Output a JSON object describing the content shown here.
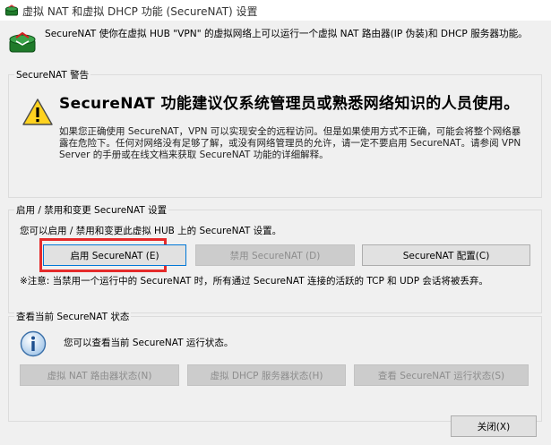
{
  "window": {
    "title": "虚拟 NAT 和虚拟 DHCP 功能 (SecureNAT) 设置"
  },
  "header": {
    "description": "SecureNAT 使你在虚拟 HUB \"VPN\" 的虚拟网络上可以运行一个虚拟 NAT 路由器(IP 伪装)和 DHCP 服务器功能。"
  },
  "warning_group": {
    "title": "SecureNAT 警告",
    "heading": "SecureNAT 功能建议仅系统管理员或熟悉网络知识的人员使用。",
    "body": "如果您正确使用 SecureNAT，VPN 可以实现安全的远程访问。但是如果使用方式不正确，可能会将整个网络暴露在危险下。任何对网络没有足够了解，或没有网络管理员的允许，请一定不要启用 SecureNAT。请参阅 VPN Server 的手册或在线文档来获取 SecureNAT 功能的详细解释。"
  },
  "enable_group": {
    "title": "启用 / 禁用和变更 SecureNAT 设置",
    "description": "您可以启用 / 禁用和变更此虚拟 HUB 上的 SecureNAT 设置。",
    "enable_label": "启用 SecureNAT (E)",
    "disable_label": "禁用 SecureNAT (D)",
    "config_label": "SecureNAT 配置(C)",
    "note": "※注意: 当禁用一个运行中的 SecureNAT 时，所有通过 SecureNAT 连接的活跃的 TCP 和 UDP 会话将被丢弃。"
  },
  "status_group": {
    "title": "查看当前 SecureNAT 状态",
    "description": "您可以查看当前 SecureNAT 运行状态。",
    "nat_status_label": "虚拟 NAT 路由器状态(N)",
    "dhcp_status_label": "虚拟 DHCP 服务器状态(H)",
    "securenat_status_label": "查看 SecureNAT 运行状态(S)"
  },
  "footer": {
    "close_label": "关闭(X)"
  }
}
